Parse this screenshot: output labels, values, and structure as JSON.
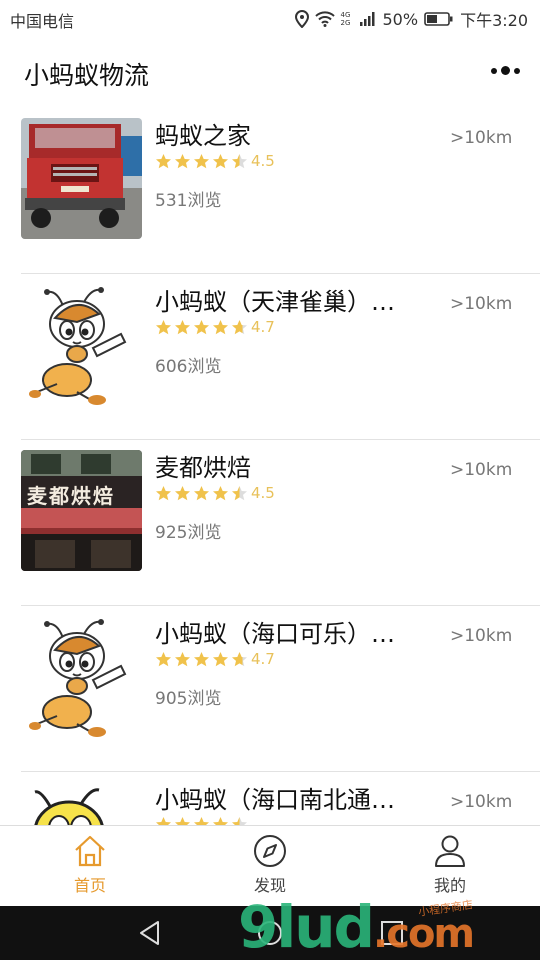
{
  "status": {
    "carrier": "中国电信",
    "network": "4G 2G",
    "battery": "50%",
    "time": "下午3:20"
  },
  "header": {
    "title": "小蚂蚁物流",
    "menu_icon": "more-dots-icon"
  },
  "items": [
    {
      "name": "蚂蚁之家",
      "rating": "4.5",
      "stars": 4.5,
      "views": "531浏览",
      "distance": ">10km",
      "thumb": "truck-photo"
    },
    {
      "name": "小蚂蚁（天津雀巢）…",
      "rating": "4.7",
      "stars": 4.7,
      "views": "606浏览",
      "distance": ">10km",
      "thumb": "ant-mascot"
    },
    {
      "name": "麦都烘焙",
      "rating": "4.5",
      "stars": 4.5,
      "views": "925浏览",
      "distance": ">10km",
      "thumb": "bakery-storefront"
    },
    {
      "name": "小蚂蚁（海口可乐）…",
      "rating": "4.7",
      "stars": 4.7,
      "views": "905浏览",
      "distance": ">10km",
      "thumb": "ant-mascot"
    },
    {
      "name": "小蚂蚁（海口南北通…",
      "rating": "",
      "stars": 4.5,
      "views": "",
      "distance": ">10km",
      "thumb": "bee-mascot"
    }
  ],
  "bakery_sign": "麦都烘焙",
  "tabs": [
    {
      "label": "首页",
      "icon": "home-icon",
      "active": true
    },
    {
      "label": "发现",
      "icon": "compass-icon",
      "active": false
    },
    {
      "label": "我的",
      "icon": "user-icon",
      "active": false
    }
  ],
  "watermark": {
    "main": "9lud",
    "domain": ".com",
    "small": "小程序商店"
  },
  "colors": {
    "accent": "#e69a2e",
    "star": "#f0c24b",
    "text_gray": "#777777"
  }
}
